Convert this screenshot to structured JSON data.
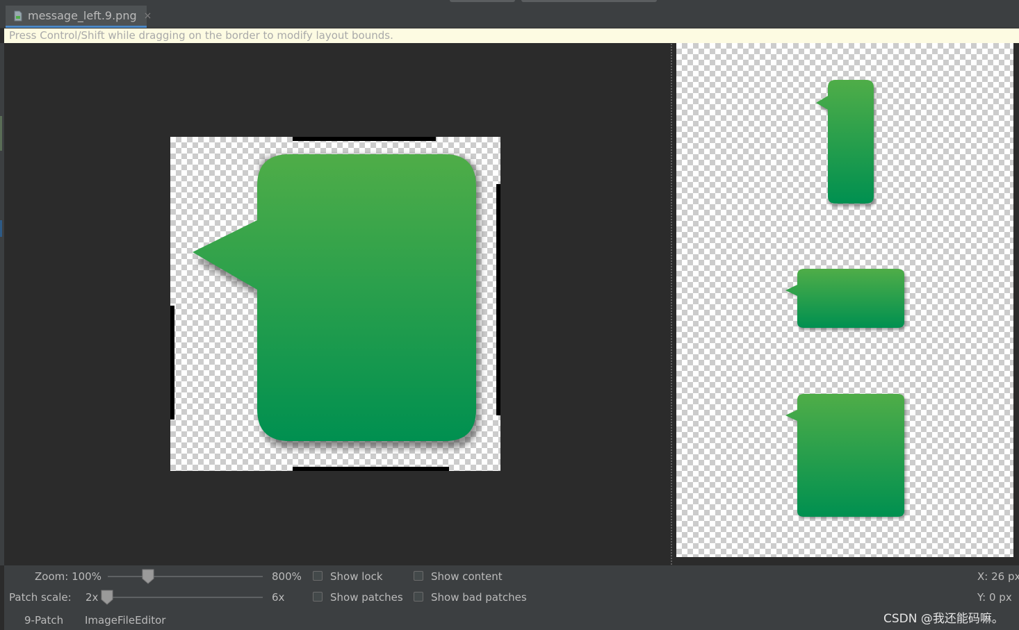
{
  "tab": {
    "filename": "message_left.9.png",
    "close": "×"
  },
  "hint": "Press Control/Shift while dragging on the border to modify layout bounds.",
  "controls": {
    "zoom_label": "Zoom: 100%",
    "zoom_max": "800%",
    "zoom_value_percent": 100,
    "patch_scale_label": "Patch scale:",
    "patch_min": "2x",
    "patch_max": "6x",
    "patch_value": 2,
    "show_lock": "Show lock",
    "show_content": "Show content",
    "show_patches": "Show patches",
    "show_bad_patches": "Show bad patches",
    "show_lock_checked": false,
    "show_content_checked": false,
    "show_patches_checked": false,
    "show_bad_patches_checked": false
  },
  "coords": {
    "x": "X: 26 px",
    "y": "Y:   0 px"
  },
  "bottom_tabs": [
    "9-Patch",
    "ImageFileEditor"
  ],
  "watermark": "CSDN @我还能码嘛。",
  "colors": {
    "bubble_top": "#4fad48",
    "bubble_bottom": "#009050",
    "accent": "#4a88c7",
    "hint_bg": "#fdfbe2"
  }
}
